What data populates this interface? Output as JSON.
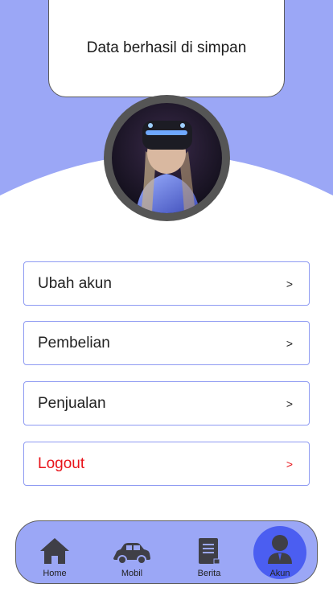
{
  "toast": {
    "message": "Data berhasil di simpan"
  },
  "profile": {
    "avatar": "avatar-photo"
  },
  "menu": [
    {
      "label": "Ubah akun",
      "arrow": ">"
    },
    {
      "label": "Pembelian",
      "arrow": ">"
    },
    {
      "label": "Penjualan",
      "arrow": ">"
    },
    {
      "label": "Logout",
      "arrow": ">"
    }
  ],
  "nav": [
    {
      "label": "Home",
      "icon": "home-icon"
    },
    {
      "label": "Mobil",
      "icon": "car-icon"
    },
    {
      "label": "Berita",
      "icon": "news-icon"
    },
    {
      "label": "Akun",
      "icon": "user-icon",
      "active": true
    }
  ],
  "colors": {
    "accent": "#9ba7f6",
    "active_nav": "#4b5ef1",
    "logout": "#e8141b",
    "border": "#8e9af2"
  }
}
